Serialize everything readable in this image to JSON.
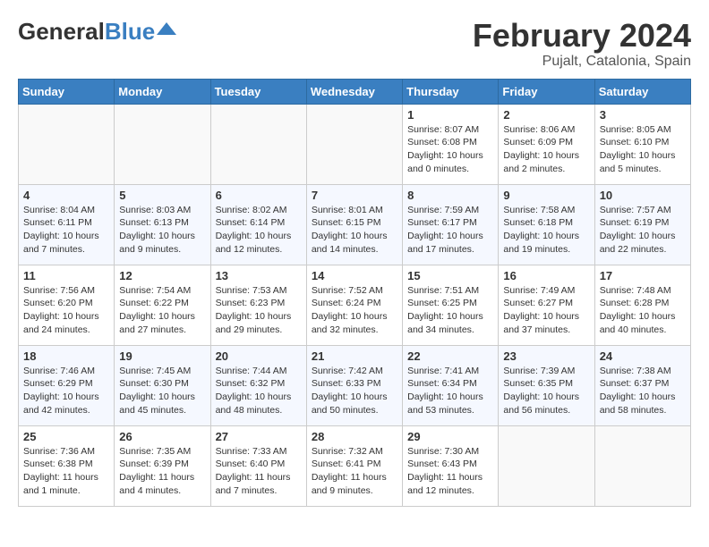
{
  "header": {
    "logo_general": "General",
    "logo_blue": "Blue",
    "month": "February 2024",
    "location": "Pujalt, Catalonia, Spain"
  },
  "weekdays": [
    "Sunday",
    "Monday",
    "Tuesday",
    "Wednesday",
    "Thursday",
    "Friday",
    "Saturday"
  ],
  "weeks": [
    [
      {
        "num": "",
        "info": ""
      },
      {
        "num": "",
        "info": ""
      },
      {
        "num": "",
        "info": ""
      },
      {
        "num": "",
        "info": ""
      },
      {
        "num": "1",
        "info": "Sunrise: 8:07 AM\nSunset: 6:08 PM\nDaylight: 10 hours\nand 0 minutes."
      },
      {
        "num": "2",
        "info": "Sunrise: 8:06 AM\nSunset: 6:09 PM\nDaylight: 10 hours\nand 2 minutes."
      },
      {
        "num": "3",
        "info": "Sunrise: 8:05 AM\nSunset: 6:10 PM\nDaylight: 10 hours\nand 5 minutes."
      }
    ],
    [
      {
        "num": "4",
        "info": "Sunrise: 8:04 AM\nSunset: 6:11 PM\nDaylight: 10 hours\nand 7 minutes."
      },
      {
        "num": "5",
        "info": "Sunrise: 8:03 AM\nSunset: 6:13 PM\nDaylight: 10 hours\nand 9 minutes."
      },
      {
        "num": "6",
        "info": "Sunrise: 8:02 AM\nSunset: 6:14 PM\nDaylight: 10 hours\nand 12 minutes."
      },
      {
        "num": "7",
        "info": "Sunrise: 8:01 AM\nSunset: 6:15 PM\nDaylight: 10 hours\nand 14 minutes."
      },
      {
        "num": "8",
        "info": "Sunrise: 7:59 AM\nSunset: 6:17 PM\nDaylight: 10 hours\nand 17 minutes."
      },
      {
        "num": "9",
        "info": "Sunrise: 7:58 AM\nSunset: 6:18 PM\nDaylight: 10 hours\nand 19 minutes."
      },
      {
        "num": "10",
        "info": "Sunrise: 7:57 AM\nSunset: 6:19 PM\nDaylight: 10 hours\nand 22 minutes."
      }
    ],
    [
      {
        "num": "11",
        "info": "Sunrise: 7:56 AM\nSunset: 6:20 PM\nDaylight: 10 hours\nand 24 minutes."
      },
      {
        "num": "12",
        "info": "Sunrise: 7:54 AM\nSunset: 6:22 PM\nDaylight: 10 hours\nand 27 minutes."
      },
      {
        "num": "13",
        "info": "Sunrise: 7:53 AM\nSunset: 6:23 PM\nDaylight: 10 hours\nand 29 minutes."
      },
      {
        "num": "14",
        "info": "Sunrise: 7:52 AM\nSunset: 6:24 PM\nDaylight: 10 hours\nand 32 minutes."
      },
      {
        "num": "15",
        "info": "Sunrise: 7:51 AM\nSunset: 6:25 PM\nDaylight: 10 hours\nand 34 minutes."
      },
      {
        "num": "16",
        "info": "Sunrise: 7:49 AM\nSunset: 6:27 PM\nDaylight: 10 hours\nand 37 minutes."
      },
      {
        "num": "17",
        "info": "Sunrise: 7:48 AM\nSunset: 6:28 PM\nDaylight: 10 hours\nand 40 minutes."
      }
    ],
    [
      {
        "num": "18",
        "info": "Sunrise: 7:46 AM\nSunset: 6:29 PM\nDaylight: 10 hours\nand 42 minutes."
      },
      {
        "num": "19",
        "info": "Sunrise: 7:45 AM\nSunset: 6:30 PM\nDaylight: 10 hours\nand 45 minutes."
      },
      {
        "num": "20",
        "info": "Sunrise: 7:44 AM\nSunset: 6:32 PM\nDaylight: 10 hours\nand 48 minutes."
      },
      {
        "num": "21",
        "info": "Sunrise: 7:42 AM\nSunset: 6:33 PM\nDaylight: 10 hours\nand 50 minutes."
      },
      {
        "num": "22",
        "info": "Sunrise: 7:41 AM\nSunset: 6:34 PM\nDaylight: 10 hours\nand 53 minutes."
      },
      {
        "num": "23",
        "info": "Sunrise: 7:39 AM\nSunset: 6:35 PM\nDaylight: 10 hours\nand 56 minutes."
      },
      {
        "num": "24",
        "info": "Sunrise: 7:38 AM\nSunset: 6:37 PM\nDaylight: 10 hours\nand 58 minutes."
      }
    ],
    [
      {
        "num": "25",
        "info": "Sunrise: 7:36 AM\nSunset: 6:38 PM\nDaylight: 11 hours\nand 1 minute."
      },
      {
        "num": "26",
        "info": "Sunrise: 7:35 AM\nSunset: 6:39 PM\nDaylight: 11 hours\nand 4 minutes."
      },
      {
        "num": "27",
        "info": "Sunrise: 7:33 AM\nSunset: 6:40 PM\nDaylight: 11 hours\nand 7 minutes."
      },
      {
        "num": "28",
        "info": "Sunrise: 7:32 AM\nSunset: 6:41 PM\nDaylight: 11 hours\nand 9 minutes."
      },
      {
        "num": "29",
        "info": "Sunrise: 7:30 AM\nSunset: 6:43 PM\nDaylight: 11 hours\nand 12 minutes."
      },
      {
        "num": "",
        "info": ""
      },
      {
        "num": "",
        "info": ""
      }
    ]
  ]
}
